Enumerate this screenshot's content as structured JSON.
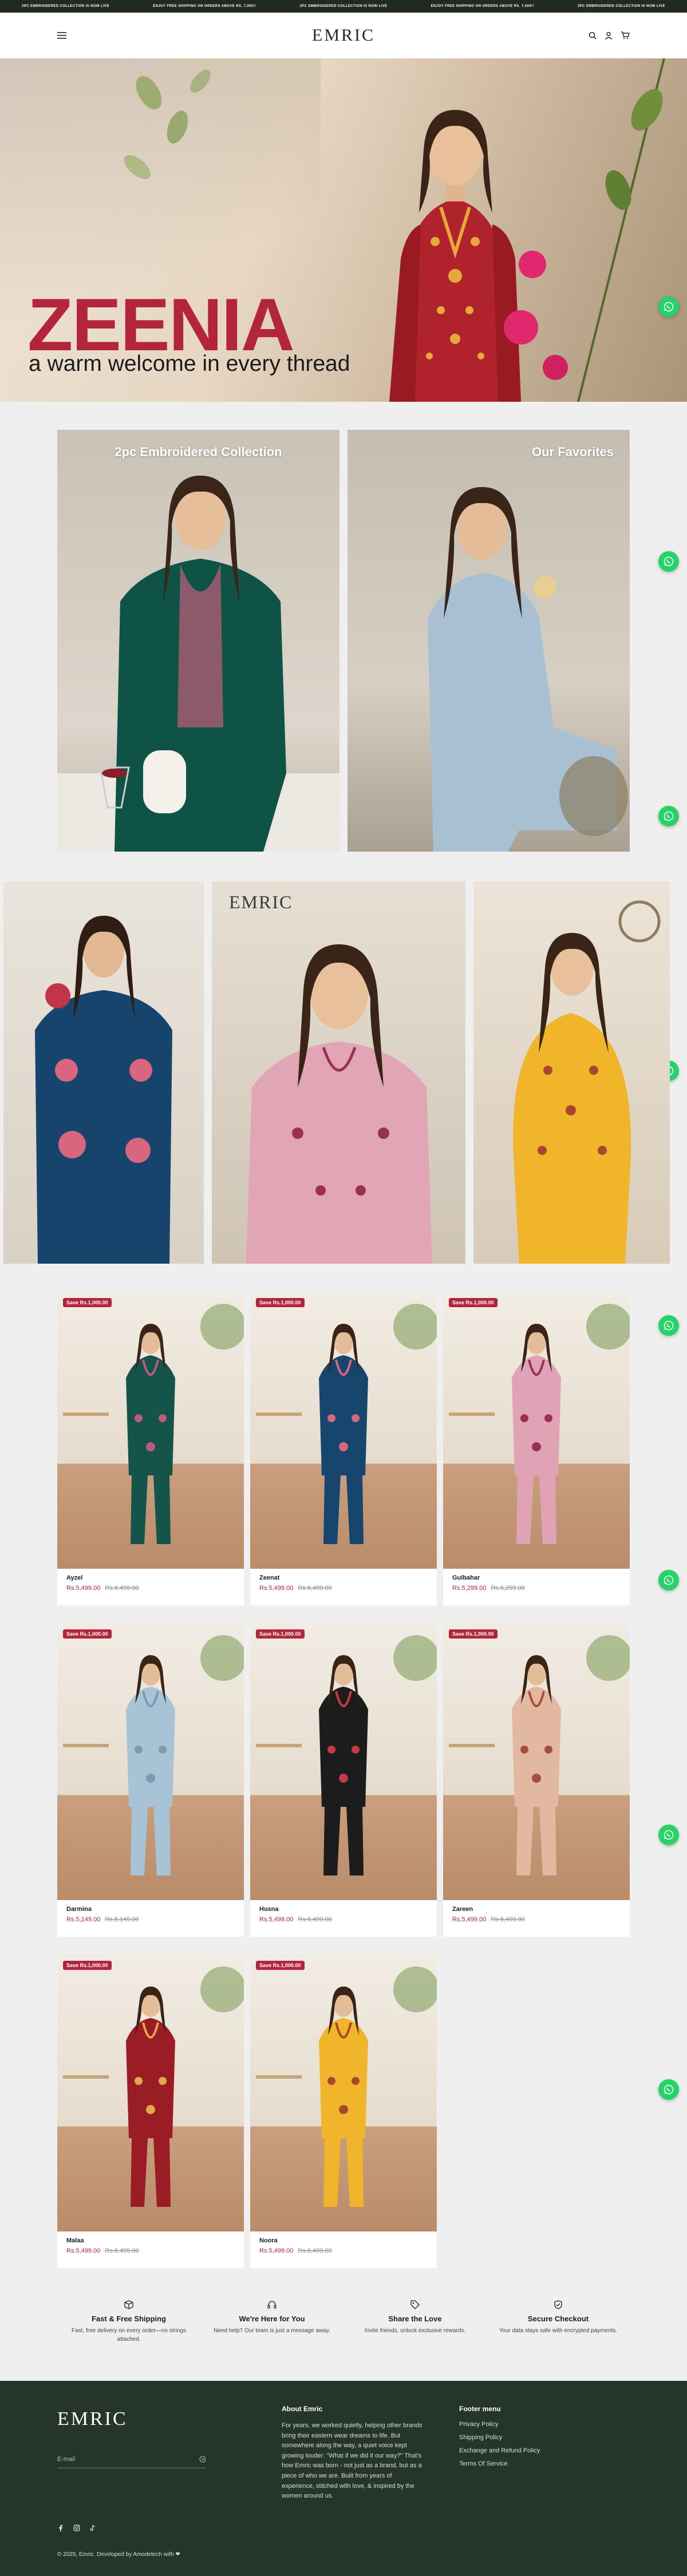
{
  "announcement": {
    "items": [
      "2PC EMBROIDERED COLLECTION IS NOW LIVE",
      "ENJOY FREE SHIPPING ON ORDERS ABOVE RS. 7,000!!",
      "2PC EMBROIDERED COLLECTION IS NOW LIVE",
      "ENJOY FREE SHIPPING ON ORDERS ABOVE RS. 7,000!!",
      "2PC EMBROIDERED COLLECTION IS NOW LIVE"
    ]
  },
  "header": {
    "logo": "EMRIC"
  },
  "hero": {
    "title": "ZEENIA",
    "subtitle": "a warm welcome in every thread"
  },
  "collections": [
    {
      "title": "2pc Embroidered Collection"
    },
    {
      "title": "Our Favorites"
    }
  ],
  "trio": {
    "logo": "EMRIC"
  },
  "products": [
    {
      "name": "Ayzel",
      "badge": "Save Rs.1,000.00",
      "price": "Rs.5,499.00",
      "compare": "Rs.6,499.00",
      "color": "#14544a",
      "accent": "#b85d7a"
    },
    {
      "name": "Zeenat",
      "badge": "Save Rs.1,000.00",
      "price": "Rs.5,499.00",
      "compare": "Rs.6,499.00",
      "color": "#16456e",
      "accent": "#d9667f"
    },
    {
      "name": "Gulbahar",
      "badge": "Save Rs.1,000.00",
      "price": "Rs.5,299.00",
      "compare": "Rs.6,299.00",
      "color": "#e0a3b6",
      "accent": "#9a3150"
    },
    {
      "name": "Darmina",
      "badge": "Save Rs.1,000.00",
      "price": "Rs.5,149.00",
      "compare": "Rs.6,149.00",
      "color": "#a9c3d6",
      "accent": "#7f9ab0"
    },
    {
      "name": "Husna",
      "badge": "Save Rs.1,000.00",
      "price": "Rs.5,499.00",
      "compare": "Rs.6,499.00",
      "color": "#1c1c1c",
      "accent": "#c43a45"
    },
    {
      "name": "Zareen",
      "badge": "Save Rs.1,000.00",
      "price": "Rs.5,499.00",
      "compare": "Rs.6,499.00",
      "color": "#e2b8a0",
      "accent": "#a2503d"
    },
    {
      "name": "Malaa",
      "badge": "Save Rs.1,000.00",
      "price": "Rs.5,499.00",
      "compare": "Rs.6,499.00",
      "color": "#9a1c24",
      "accent": "#e0a94c"
    },
    {
      "name": "Noora",
      "badge": "Save Rs.1,000.00",
      "price": "Rs.5,499.00",
      "compare": "Rs.6,499.00",
      "color": "#f0b52a",
      "accent": "#a8472e"
    }
  ],
  "features": [
    {
      "icon": "box-icon",
      "title": "Fast & Free Shipping",
      "text": "Fast, free delivery on every order—no strings attached."
    },
    {
      "icon": "headset-icon",
      "title": "We're Here for You",
      "text": "Need help? Our team is just a message away."
    },
    {
      "icon": "tag-icon",
      "title": "Share the Love",
      "text": "Invite friends, unlock exclusive rewards."
    },
    {
      "icon": "shield-icon",
      "title": "Secure Checkout",
      "text": "Your data stays safe with encrypted payments."
    }
  ],
  "footer": {
    "logo": "EMRIC",
    "email_placeholder": "E-mail",
    "about_heading": "About Emric",
    "about_text": "For years, we worked quietly, helping other brands bring their eastern wear dreams to life. But somewhere along the way, a quiet voice kept growing louder: \"What if we did it our way?\" That's how Emric was born - not just as a brand, but as a piece of who we are. Built from years of experience, stitched with love, & inspired by the women around us.",
    "menu_heading": "Footer menu",
    "menu_items": [
      "Privacy Policy",
      "Shipping Policy",
      "Exchange and Refund Policy",
      "Terms Of Service"
    ],
    "copyright": "© 2025, Emric. Developed by Amodetech with ❤"
  }
}
